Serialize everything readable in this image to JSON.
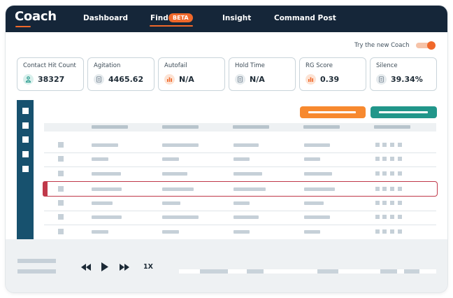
{
  "app": {
    "logo": "Coach",
    "nav": [
      "Dashboard",
      "Find",
      "Insight",
      "Command Post"
    ],
    "active_nav": "Find",
    "find_badge": "BETA",
    "accent_color": "#f0682a",
    "nav_bg_color": "#152639"
  },
  "toggle": {
    "label": "Try the new Coach",
    "state": "on"
  },
  "stats": [
    {
      "label": "Contact Hit Count",
      "value": "38327",
      "icon": "person-icon"
    },
    {
      "label": "Agitation",
      "value": "4465.62",
      "icon": "document-icon"
    },
    {
      "label": "Autofail",
      "value": "N/A",
      "icon": "bar-chart-icon"
    },
    {
      "label": "Hold Time",
      "value": "N/A",
      "icon": "document-icon"
    },
    {
      "label": "RG Score",
      "value": "0.39",
      "icon": "bar-chart-icon"
    },
    {
      "label": "Silence",
      "value": "39.34%",
      "icon": "document-icon"
    }
  ],
  "actions": {
    "primary_color": "#f7892f",
    "secondary_color": "#21968a"
  },
  "player": {
    "speed": "1X",
    "controls": [
      "rewind-icon",
      "play-icon",
      "fast-forward-icon"
    ]
  }
}
